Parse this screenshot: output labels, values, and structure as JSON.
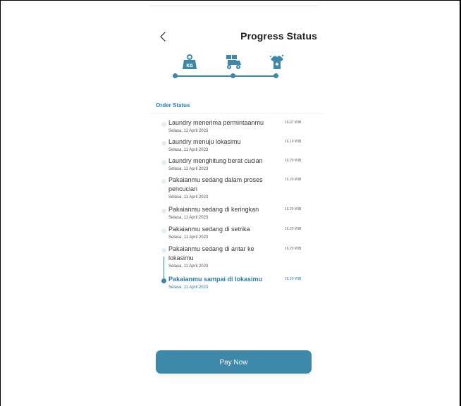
{
  "header": {
    "back_icon": "chevron-left-icon",
    "title": "Progress Status"
  },
  "steps": [
    {
      "icon": "weight-kg-icon",
      "label": "KG"
    },
    {
      "icon": "delivery-scooter-icon"
    },
    {
      "icon": "clean-shirt-icon"
    }
  ],
  "colors": {
    "accent": "#3d87a8",
    "accent_text": "#2f7da6",
    "inactive_dot": "#e3eef5"
  },
  "order_status": {
    "heading": "Order Status",
    "items": [
      {
        "title": "Laundry menerima permintaanmu",
        "date": "Selasa, 11 April 2023",
        "time": "16.07 WIB"
      },
      {
        "title": "Laundry menuju lokasimu",
        "date": "Selasa, 11 April 2023",
        "time": "16.10 WIB"
      },
      {
        "title": "Laundry menghitung berat cucian",
        "date": "Selasa, 11 April 2023",
        "time": "16.20 WIB"
      },
      {
        "title": "Pakaianmu sedang dalam proses pencucian",
        "date": "Selasa, 11 April 2023",
        "time": "16.20 WIB"
      },
      {
        "title": "Pakaianmu sedang di keringkan",
        "date": "Selasa, 11 April 2023",
        "time": "16.20 WIB"
      },
      {
        "title": "Pakaianmu sedang di setrika",
        "date": "Selasa, 11 April 2023",
        "time": "16.20 WIB"
      },
      {
        "title": "Pakaianmu sedang di antar ke lokasimu",
        "date": "Selasa, 11 April 2023",
        "time": "16.20 WIB"
      },
      {
        "title": "Pakaianmu sampai di lokasimu",
        "date": "Selasa, 11 April 2023",
        "time": "16.20 WIB",
        "active": true
      }
    ]
  },
  "pay_button": {
    "label": "Pay Now"
  }
}
